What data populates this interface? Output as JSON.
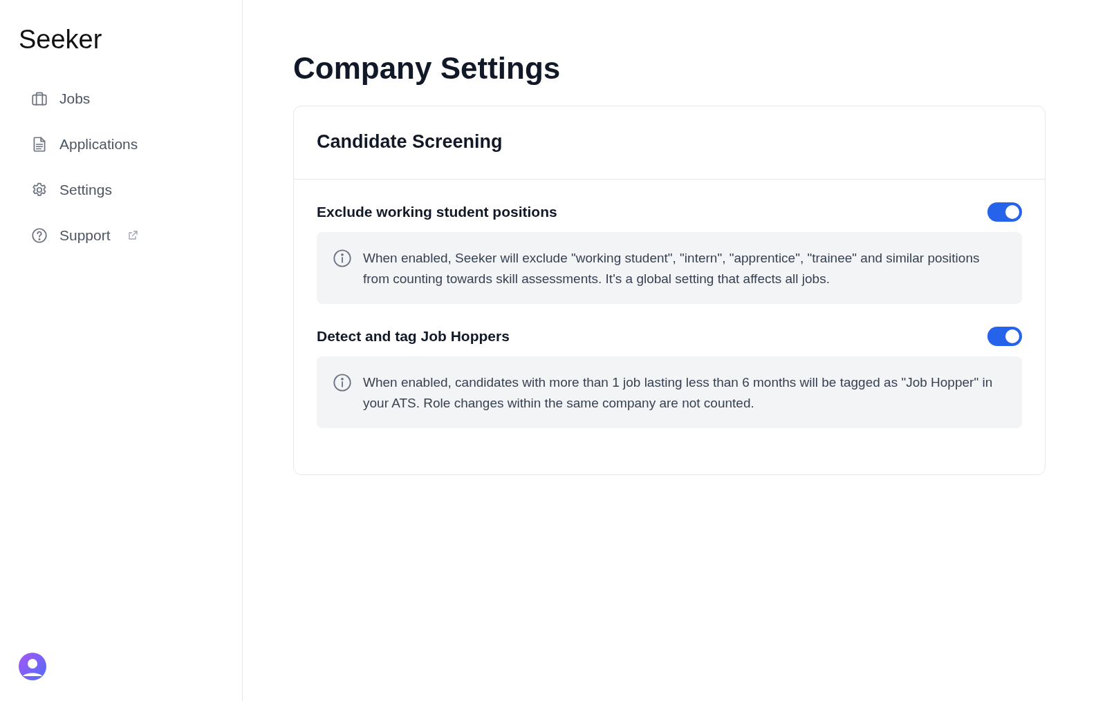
{
  "sidebar": {
    "logo": "Seeker",
    "items": [
      {
        "label": "Jobs",
        "external": false
      },
      {
        "label": "Applications",
        "external": false
      },
      {
        "label": "Settings",
        "external": false
      },
      {
        "label": "Support",
        "external": true
      }
    ]
  },
  "page": {
    "title": "Company Settings"
  },
  "card": {
    "title": "Candidate Screening",
    "settings": [
      {
        "label": "Exclude working student positions",
        "on": true,
        "info": "When enabled, Seeker will exclude \"working student\", \"intern\", \"apprentice\", \"trainee\" and similar positions from counting towards skill assessments. It's a global setting that affects all jobs."
      },
      {
        "label": "Detect and tag Job Hoppers",
        "on": true,
        "info": "When enabled, candidates with more than 1 job lasting less than 6 months will be tagged as \"Job Hopper\" in your ATS. Role changes within the same company are not counted."
      }
    ]
  }
}
